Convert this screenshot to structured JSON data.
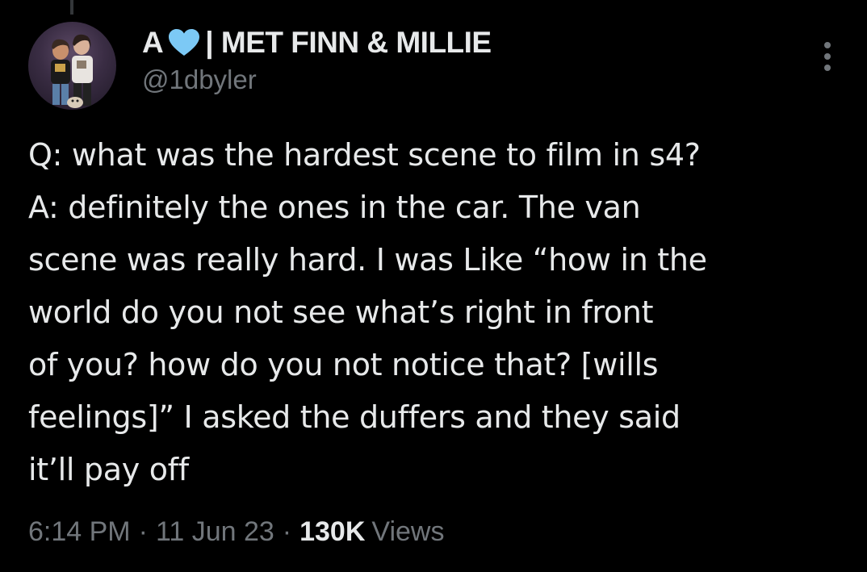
{
  "author": {
    "display_name_prefix": "A",
    "display_name_suffix": "| MET FINN & MILLIE",
    "handle": "@1dbyler",
    "avatar_icon": "profile-photo",
    "name_emoji_icon": "light-blue-heart-icon"
  },
  "tweet": {
    "lines": [
      "Q: what was the hardest scene to film in s4?",
      "A: definitely the ones in the car. The van",
      "scene was really hard. I was Like “how in the",
      "world do you not see what’s right in front",
      "of you? how do you not notice that? [wills",
      "feelings]” I asked the duffers and they said",
      "it’ll pay off"
    ]
  },
  "meta": {
    "time": "6:14 PM",
    "separator": "·",
    "date": "11 Jun 23",
    "views_count": "130K",
    "views_label": "Views"
  },
  "more_icon": "more-vertical-icon",
  "colors": {
    "background": "#000000",
    "text_primary": "#e7e9ea",
    "text_secondary": "#71767b",
    "heart": "#7cc9f5"
  }
}
